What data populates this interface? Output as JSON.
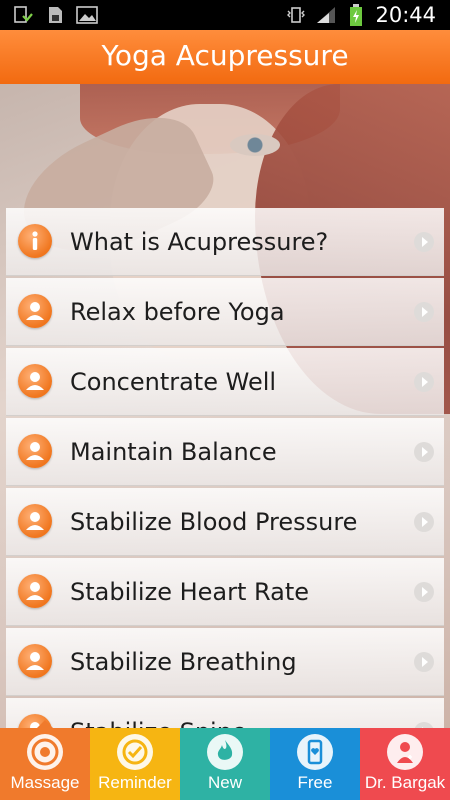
{
  "status_bar": {
    "time": "20:44",
    "left_icons": [
      "download-done-icon",
      "sd-card-icon",
      "image-icon"
    ],
    "right_icons": [
      "vibrate-icon",
      "signal-icon",
      "battery-charging-icon"
    ]
  },
  "app_bar": {
    "title": "Yoga Acupressure"
  },
  "colors": {
    "app_bar": "#f47a25",
    "tab_massage": "#f07a2c",
    "tab_reminder": "#f6b512",
    "tab_new": "#2eb2a4",
    "tab_free": "#1a8fd8",
    "tab_dr": "#ef4a4f"
  },
  "menu": {
    "items": [
      {
        "label": "What is Acupressure?",
        "icon": "info-icon"
      },
      {
        "label": "Relax before Yoga",
        "icon": "person-icon"
      },
      {
        "label": "Concentrate Well",
        "icon": "person-icon"
      },
      {
        "label": "Maintain Balance",
        "icon": "person-icon"
      },
      {
        "label": "Stabilize Blood Pressure",
        "icon": "person-icon"
      },
      {
        "label": "Stabilize Heart Rate",
        "icon": "person-icon"
      },
      {
        "label": "Stabilize Breathing",
        "icon": "person-icon"
      },
      {
        "label": "Stabilize Spine",
        "icon": "person-icon"
      }
    ]
  },
  "bottom_nav": {
    "tabs": [
      {
        "label": "Massage",
        "icon": "target-icon",
        "active": true
      },
      {
        "label": "Reminder",
        "icon": "check-badge-icon"
      },
      {
        "label": "New",
        "icon": "flame-icon"
      },
      {
        "label": "Free",
        "icon": "phone-heart-icon"
      },
      {
        "label": "Dr. Bargak",
        "icon": "doctor-icon"
      }
    ]
  }
}
